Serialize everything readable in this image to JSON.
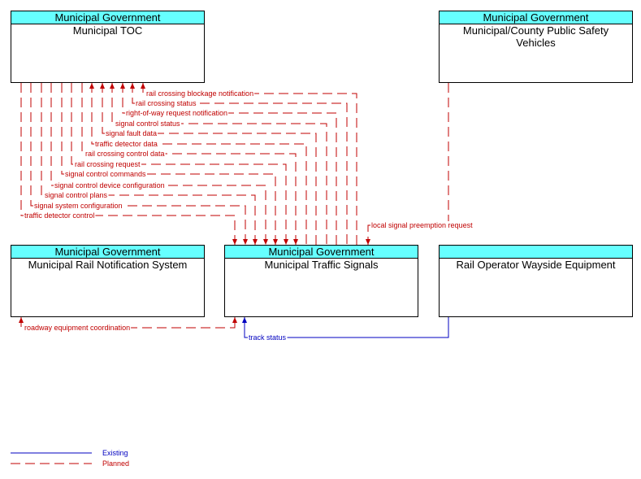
{
  "colors": {
    "planned": "#c00000",
    "existing": "#0000c0",
    "header": "#66ffff"
  },
  "boxes": {
    "toc": {
      "org": "Municipal Government",
      "name": "Municipal TOC"
    },
    "psv": {
      "org": "Municipal Government",
      "name": "Municipal/County Public Safety Vehicles"
    },
    "rns": {
      "org": "Municipal Government",
      "name": "Municipal Rail Notification System"
    },
    "mts": {
      "org": "Municipal Government",
      "name": "Municipal Traffic Signals"
    },
    "row": {
      "org": "",
      "name": "Rail Operator Wayside Equipment"
    }
  },
  "flows": [
    {
      "label": "rail crossing blockage notification",
      "from": "Municipal Traffic Signals",
      "to": "Municipal TOC",
      "status": "planned"
    },
    {
      "label": "rail crossing status",
      "from": "Municipal Traffic Signals",
      "to": "Municipal TOC",
      "status": "planned"
    },
    {
      "label": "right-of-way request notification",
      "from": "Municipal Traffic Signals",
      "to": "Municipal TOC",
      "status": "planned"
    },
    {
      "label": "signal control status",
      "from": "Municipal Traffic Signals",
      "to": "Municipal TOC",
      "status": "planned"
    },
    {
      "label": "signal fault data",
      "from": "Municipal Traffic Signals",
      "to": "Municipal TOC",
      "status": "planned"
    },
    {
      "label": "traffic detector data",
      "from": "Municipal Traffic Signals",
      "to": "Municipal TOC",
      "status": "planned"
    },
    {
      "label": "rail crossing control data",
      "from": "Municipal TOC",
      "to": "Municipal Traffic Signals",
      "status": "planned"
    },
    {
      "label": "rail crossing request",
      "from": "Municipal TOC",
      "to": "Municipal Traffic Signals",
      "status": "planned"
    },
    {
      "label": "signal control commands",
      "from": "Municipal TOC",
      "to": "Municipal Traffic Signals",
      "status": "planned"
    },
    {
      "label": "signal control device configuration",
      "from": "Municipal TOC",
      "to": "Municipal Traffic Signals",
      "status": "planned"
    },
    {
      "label": "signal control plans",
      "from": "Municipal TOC",
      "to": "Municipal Traffic Signals",
      "status": "planned"
    },
    {
      "label": "signal system configuration",
      "from": "Municipal TOC",
      "to": "Municipal Traffic Signals",
      "status": "planned"
    },
    {
      "label": "traffic detector control",
      "from": "Municipal TOC",
      "to": "Municipal Traffic Signals",
      "status": "planned"
    },
    {
      "label": "local signal preemption request",
      "from": "Municipal/County Public Safety Vehicles",
      "to": "Municipal Traffic Signals",
      "status": "planned"
    },
    {
      "label": "roadway equipment coordination",
      "from": "Municipal Traffic Signals",
      "to": "Municipal Rail Notification System",
      "status": "planned",
      "bidirectional": true
    },
    {
      "label": "track status",
      "from": "Rail Operator Wayside Equipment",
      "to": "Municipal Traffic Signals",
      "status": "existing"
    }
  ],
  "legend": {
    "existing": "Existing",
    "planned": "Planned"
  }
}
